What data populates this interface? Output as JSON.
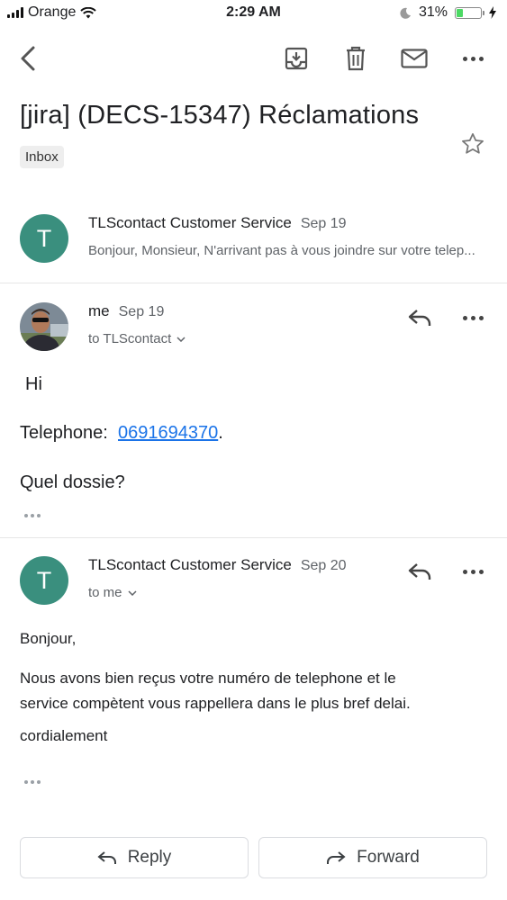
{
  "status_bar": {
    "carrier": "Orange",
    "time": "2:29 AM",
    "battery_percent": "31%",
    "battery_level": 0.31,
    "battery_color": "#4cd964"
  },
  "toolbar": {
    "icons": [
      "back-icon",
      "archive-icon",
      "trash-icon",
      "mail-icon",
      "more-icon"
    ]
  },
  "thread": {
    "subject": "[jira]  (DECS-15347) Réclamations",
    "label": "Inbox",
    "accent_avatar_color": "#3a8f7e",
    "link_color": "#1a73e8"
  },
  "messages": [
    {
      "avatar_letter": "T",
      "sender": "TLScontact Customer Service",
      "date": "Sep 19",
      "snippet": "Bonjour, Monsieur, N'arrivant pas à vous joindre sur votre telep..."
    },
    {
      "sender": "me",
      "date": "Sep 19",
      "to": "to TLScontact",
      "body": {
        "greeting": "Hi",
        "phone_label": "Telephone:",
        "phone_number": "0691694370",
        "phone_suffix": ".",
        "question": "Quel dossie?"
      }
    },
    {
      "avatar_letter": "T",
      "sender": "TLScontact Customer Service",
      "date": "Sep 20",
      "to": "to me",
      "body": {
        "greeting": "Bonjour,",
        "line1": "Nous avons bien reçus votre numéro de telephone et le",
        "line2": "service compètent vous rappellera dans le plus bref delai.",
        "closing": "cordialement"
      }
    }
  ],
  "actions": {
    "reply": "Reply",
    "forward": "Forward"
  }
}
